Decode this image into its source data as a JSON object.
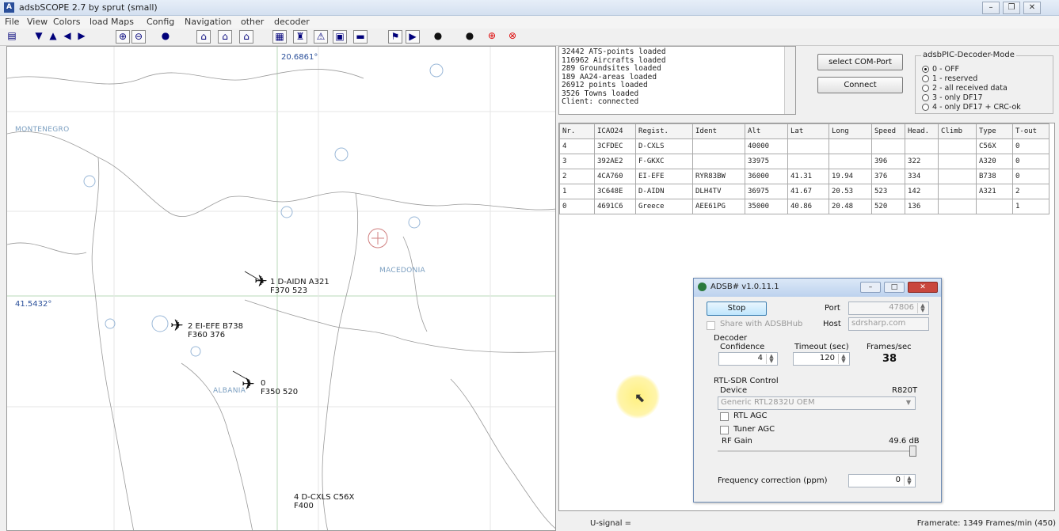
{
  "titlebar": {
    "title": "adsbSCOPE 2.7 by sprut  (small)"
  },
  "menu": [
    "File",
    "View",
    "Colors",
    "load Maps",
    "Config",
    "Navigation",
    "other",
    "decoder"
  ],
  "toolbar": {
    "icons": [
      "grid-icon",
      "nav-up-down-icon",
      "nav-up-icon",
      "nav-left-icon",
      "nav-right-icon",
      "zoom-in-icon",
      "zoom-out-icon",
      "globe-icon",
      "radar-icon",
      "radar2-icon",
      "house-icon",
      "list-icon",
      "marker-icon",
      "warning-icon",
      "screen-icon",
      "monitor-icon",
      "network-icon",
      "play-icon",
      "record-icon",
      "stop-icon",
      "target-icon",
      "target2-icon"
    ]
  },
  "map": {
    "coord_top": "20.6861°",
    "coord_left": "41.5432°",
    "countries": [
      "MONTENEGRO",
      "MACEDONIA",
      "ALBANIA"
    ],
    "aircraft": [
      {
        "line1": "1 D-AIDN  A321",
        "line2": "F370  523"
      },
      {
        "line1": "2 EI-EFE  B738",
        "line2": "F360  376"
      },
      {
        "line1": "0",
        "line2": "F350  520"
      },
      {
        "line1": "4 D-CXLS  C56X",
        "line2": "F400"
      }
    ],
    "markers": [
      "N",
      "P",
      "P",
      "P",
      "C",
      "T",
      "E",
      "E"
    ]
  },
  "log": {
    "lines": [
      "32442 ATS-points loaded",
      "116962 Aircrafts loaded",
      "289 Groundsites loaded",
      "189 AA24-areas loaded",
      "26912 points loaded",
      "3526 Towns loaded",
      "Client: connected"
    ]
  },
  "controls": {
    "select_com": "select COM-Port",
    "connect": "Connect"
  },
  "decoder_mode": {
    "legend": "adsbPIC-Decoder-Mode",
    "options": [
      "0 - OFF",
      "1 - reserved",
      "2 - all received data",
      "3 - only DF17",
      "4 - only DF17 + CRC-ok"
    ],
    "selected": 0
  },
  "grid": {
    "headers": [
      "Nr.",
      "ICAO24",
      "Regist.",
      "Ident",
      "Alt",
      "Lat",
      "Long",
      "Speed",
      "Head.",
      "Climb",
      "Type",
      "T-out"
    ],
    "rows": [
      [
        "4",
        "3CFDEC",
        "D-CXLS",
        "",
        "40000",
        "",
        "",
        "",
        "",
        "",
        "C56X",
        "0"
      ],
      [
        "3",
        "392AE2",
        "F-GKXC",
        "",
        "33975",
        "",
        "",
        "396",
        "322",
        "",
        "A320",
        "0"
      ],
      [
        "2",
        "4CA760",
        "EI-EFE",
        "RYR83BW",
        "36000",
        "41.31",
        "19.94",
        "376",
        "334",
        "",
        "B738",
        "0"
      ],
      [
        "1",
        "3C648E",
        "D-AIDN",
        "DLH4TV",
        "36975",
        "41.67",
        "20.53",
        "523",
        "142",
        "",
        "A321",
        "2"
      ],
      [
        "0",
        "4691C6",
        "Greece",
        "AEE61PG",
        "35000",
        "40.86",
        "20.48",
        "520",
        "136",
        "",
        "",
        "1"
      ]
    ]
  },
  "status": {
    "usignal": "U-signal =",
    "framerate": "Framerate:  1349 Frames/min (450)"
  },
  "dialog": {
    "title": "ADSB# v1.0.11.1",
    "stop": "Stop",
    "port_label": "Port",
    "port_value": "47806",
    "share_label": "Share with ADSBHub",
    "host_label": "Host",
    "host_value": "sdrsharp.com",
    "decoder_label": "Decoder",
    "confidence_label": "Confidence",
    "confidence_value": "4",
    "timeout_label": "Timeout (sec)",
    "timeout_value": "120",
    "fps_label": "Frames/sec",
    "fps_value": "38",
    "rtl_label": "RTL-SDR Control",
    "device_label": "Device",
    "device_tuner": "R820T",
    "device_value": "Generic RTL2832U OEM",
    "rtl_agc": "RTL AGC",
    "tuner_agc": "Tuner AGC",
    "rf_gain_label": "RF Gain",
    "rf_gain_value": "49.6 dB",
    "freq_label": "Frequency correction (ppm)",
    "freq_value": "0"
  }
}
